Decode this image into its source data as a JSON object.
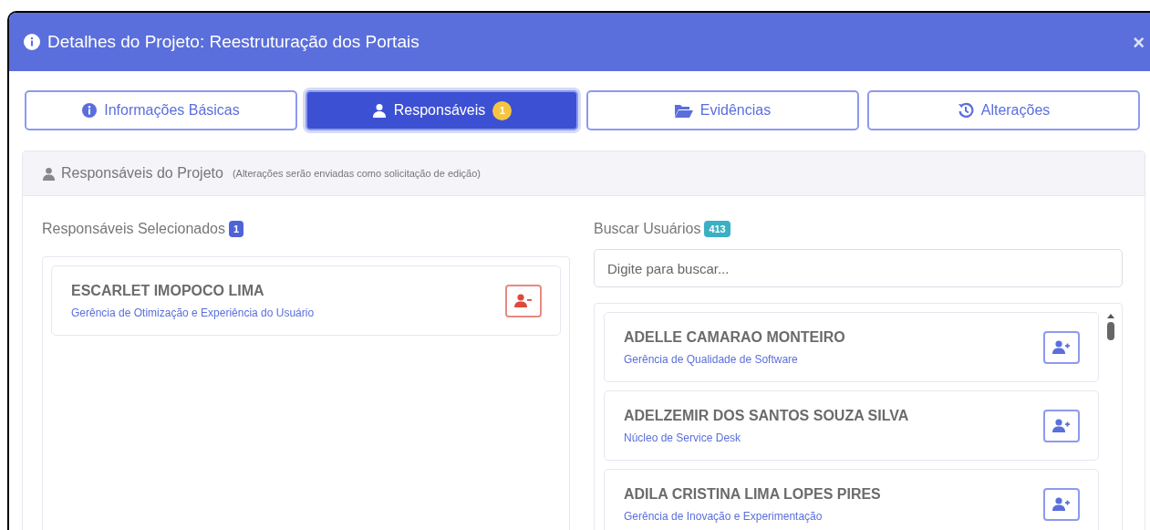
{
  "window": {
    "title": "Detalhes do Projeto: Reestruturação dos Portais",
    "close": "×"
  },
  "tabs": [
    {
      "label": "Informações Básicas",
      "kind": "info",
      "selected": false
    },
    {
      "label": "Responsáveis",
      "kind": "user",
      "selected": true,
      "badge": "1"
    },
    {
      "label": "Evidências",
      "kind": "folder",
      "selected": false
    },
    {
      "label": "Alterações",
      "kind": "history",
      "selected": false
    }
  ],
  "section": {
    "title": "Responsáveis do Projeto",
    "note": "(Alterações serão enviadas como solicitação de edição)"
  },
  "selected_panel": {
    "title": "Responsáveis Selecionados",
    "count": "1",
    "people": [
      {
        "name": "ESCARLET IMOPOCO LIMA",
        "unit": "Gerência de Otimização e Experiência do Usuário"
      }
    ]
  },
  "search_panel": {
    "title": "Buscar Usuários",
    "count": "413",
    "search": {
      "placeholder": "Digite para buscar..."
    },
    "users": [
      {
        "name": "ADELLE CAMARAO MONTEIRO",
        "unit": "Gerência de Qualidade de Software"
      },
      {
        "name": "ADELZEMIR DOS SANTOS SOUZA SILVA",
        "unit": "Núcleo de Service Desk"
      },
      {
        "name": "ADILA CRISTINA LIMA LOPES PIRES",
        "unit": "Gerência de Inovação e Experimentação"
      }
    ]
  }
}
